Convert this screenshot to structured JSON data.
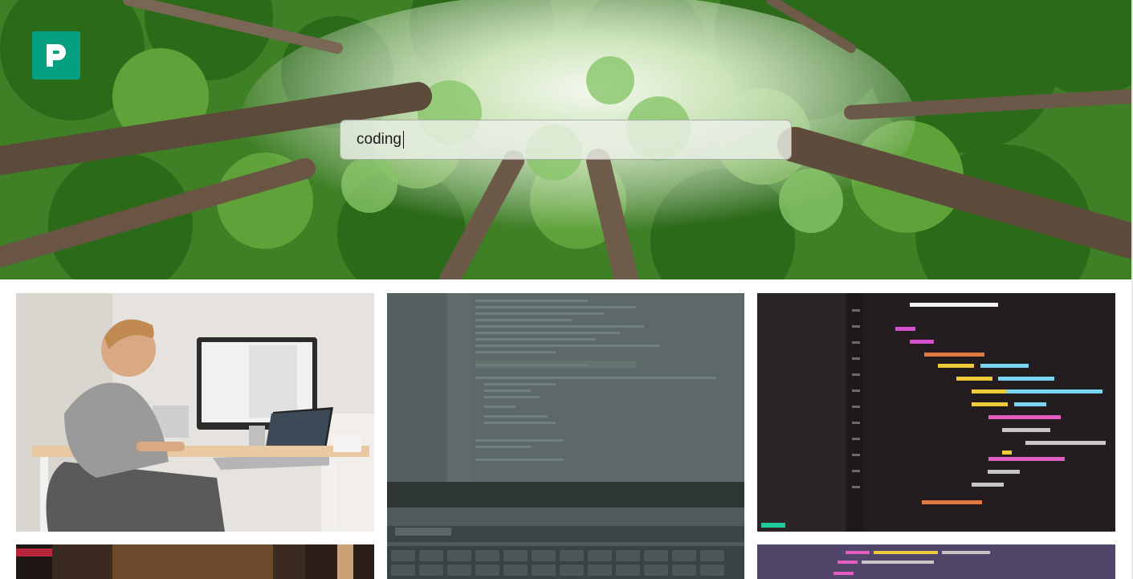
{
  "search": {
    "value": "coding"
  },
  "icons": {
    "logo": "pexels-logo-icon"
  },
  "colors": {
    "brand": "#05a081"
  },
  "gallery": {
    "photos": [
      {
        "name": "photo-man-at-desk-with-imac"
      },
      {
        "name": "photo-laptop-code-screen"
      },
      {
        "name": "photo-react-code-closeup"
      },
      {
        "name": "photo-dim-room"
      },
      {
        "name": "photo-html-code-purple"
      }
    ]
  }
}
